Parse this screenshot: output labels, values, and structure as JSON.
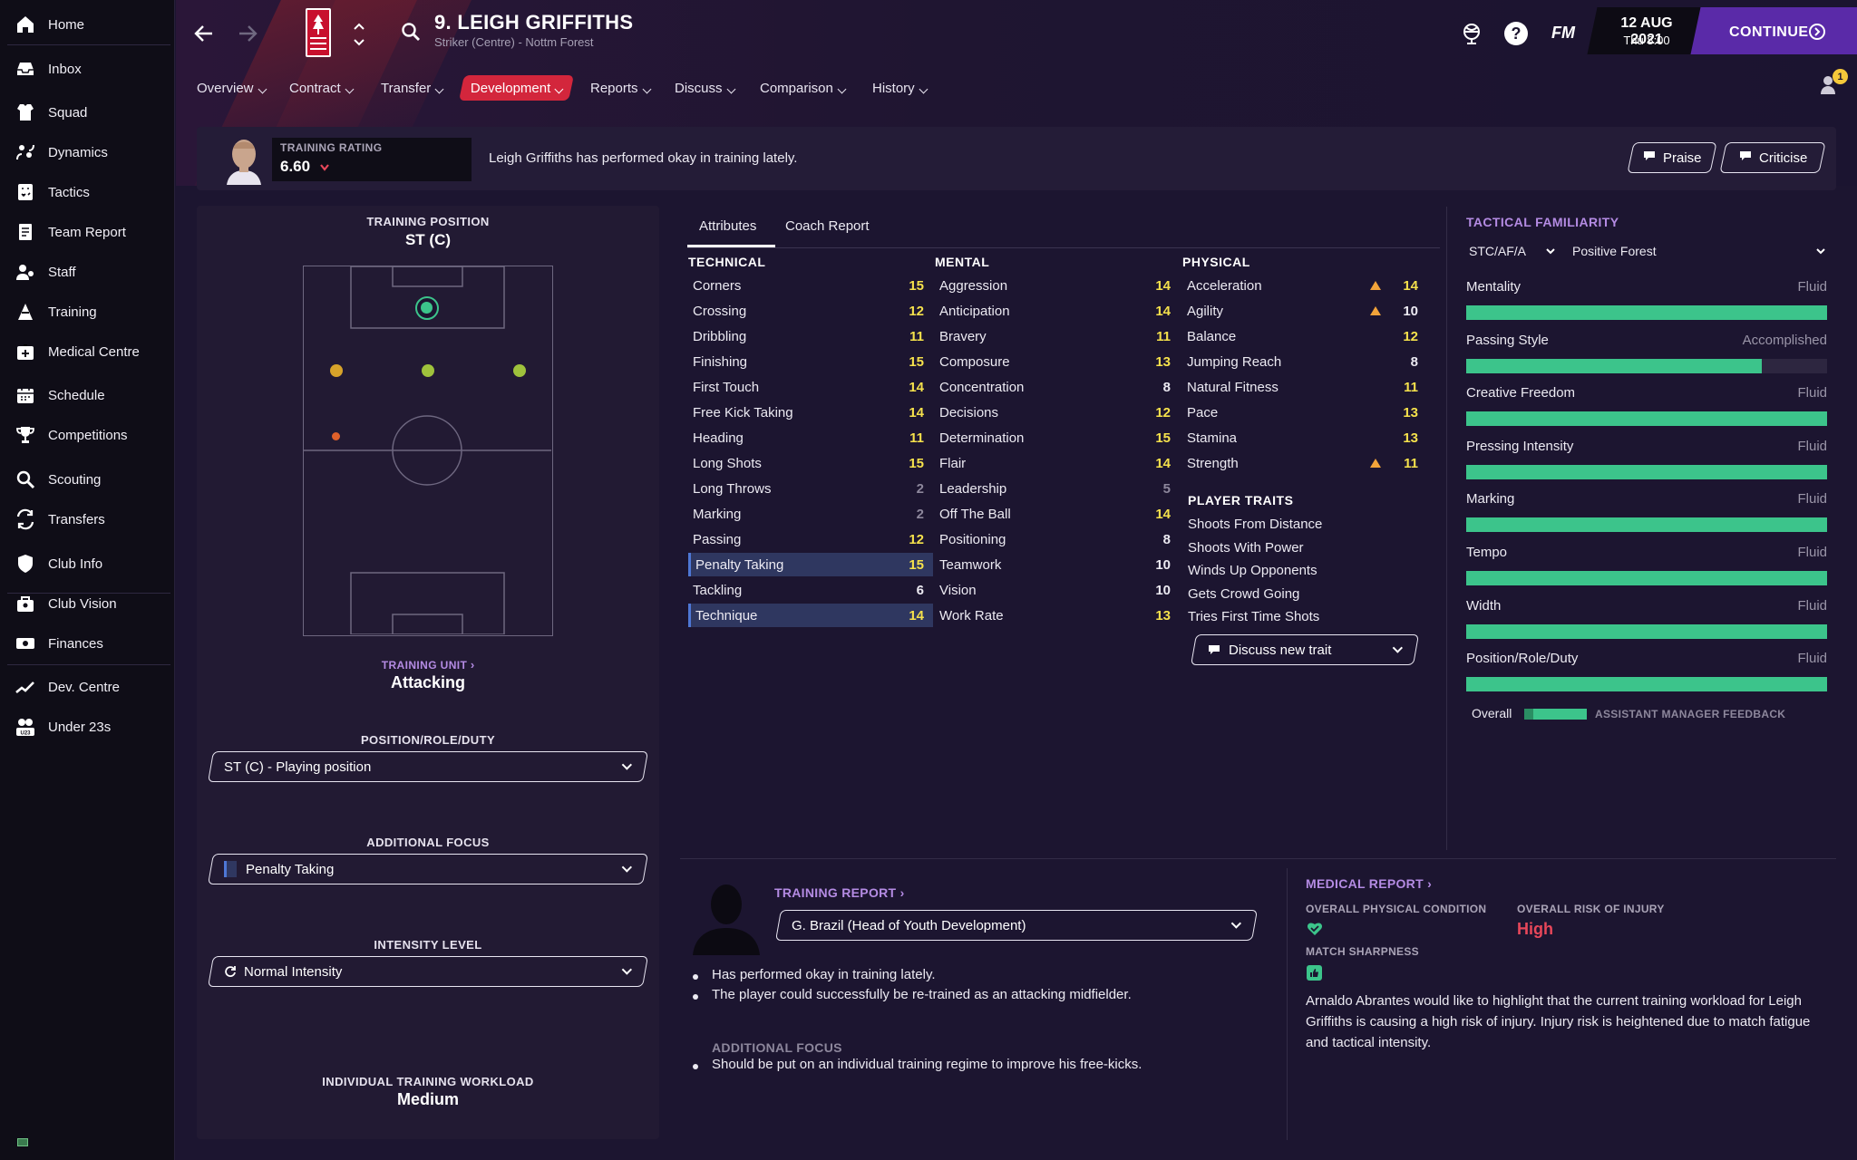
{
  "sidebar": {
    "items": [
      {
        "label": "Home",
        "icon": "home-icon"
      },
      {
        "label": "Inbox",
        "icon": "inbox-icon"
      },
      {
        "label": "Squad",
        "icon": "squad-icon"
      },
      {
        "label": "Dynamics",
        "icon": "dynamics-icon"
      },
      {
        "label": "Tactics",
        "icon": "tactics-icon"
      },
      {
        "label": "Team Report",
        "icon": "report-icon"
      },
      {
        "label": "Staff",
        "icon": "staff-icon"
      },
      {
        "label": "Training",
        "icon": "training-icon"
      },
      {
        "label": "Medical Centre",
        "icon": "medical-icon"
      },
      {
        "label": "Schedule",
        "icon": "calendar-icon"
      },
      {
        "label": "Competitions",
        "icon": "trophy-icon"
      },
      {
        "label": "Scouting",
        "icon": "search-icon"
      },
      {
        "label": "Transfers",
        "icon": "transfer-icon"
      },
      {
        "label": "Club Info",
        "icon": "shield-icon"
      },
      {
        "label": "Club Vision",
        "icon": "vision-icon"
      },
      {
        "label": "Finances",
        "icon": "finances-icon"
      },
      {
        "label": "Dev. Centre",
        "icon": "chart-icon"
      },
      {
        "label": "Under 23s",
        "icon": "u23-icon"
      }
    ]
  },
  "header": {
    "player_title": "9. LEIGH GRIFFITHS",
    "player_sub": "Striker (Centre) - Nottm Forest",
    "fm_label": "FM",
    "date": "12 AUG 2021",
    "time": "Thu 8:00",
    "continue_label": "CONTINUE",
    "notification_count": "1",
    "tabs": [
      "Overview",
      "Contract",
      "Transfer",
      "Development",
      "Reports",
      "Discuss",
      "Comparison",
      "History"
    ],
    "active_tab": "Development"
  },
  "rating": {
    "label": "TRAINING RATING",
    "value": "6.60",
    "message": "Leigh Griffiths has performed okay in training lately.",
    "praise": "Praise",
    "criticise": "Criticise"
  },
  "left": {
    "training_position_label": "TRAINING POSITION",
    "training_position": "ST (C)",
    "training_unit_label": "TRAINING UNIT",
    "training_unit": "Attacking",
    "prd_label": "POSITION/ROLE/DUTY",
    "prd_value": "ST (C) - Playing position",
    "focus_label": "ADDITIONAL FOCUS",
    "focus_value": "Penalty Taking",
    "intensity_label": "INTENSITY LEVEL",
    "intensity_value": "Normal Intensity",
    "workload_label": "INDIVIDUAL TRAINING WORKLOAD",
    "workload_value": "Medium"
  },
  "attr_tabs": [
    "Attributes",
    "Coach Report"
  ],
  "technical": {
    "title": "TECHNICAL",
    "rows": [
      {
        "name": "Corners",
        "value": "15"
      },
      {
        "name": "Crossing",
        "value": "12"
      },
      {
        "name": "Dribbling",
        "value": "11"
      },
      {
        "name": "Finishing",
        "value": "15"
      },
      {
        "name": "First Touch",
        "value": "14"
      },
      {
        "name": "Free Kick Taking",
        "value": "14"
      },
      {
        "name": "Heading",
        "value": "11"
      },
      {
        "name": "Long Shots",
        "value": "15"
      },
      {
        "name": "Long Throws",
        "value": "2"
      },
      {
        "name": "Marking",
        "value": "2"
      },
      {
        "name": "Passing",
        "value": "12"
      },
      {
        "name": "Penalty Taking",
        "value": "15",
        "hl": true
      },
      {
        "name": "Tackling",
        "value": "6"
      },
      {
        "name": "Technique",
        "value": "14",
        "hl": true
      }
    ]
  },
  "mental": {
    "title": "MENTAL",
    "rows": [
      {
        "name": "Aggression",
        "value": "14"
      },
      {
        "name": "Anticipation",
        "value": "14"
      },
      {
        "name": "Bravery",
        "value": "11"
      },
      {
        "name": "Composure",
        "value": "13"
      },
      {
        "name": "Concentration",
        "value": "8"
      },
      {
        "name": "Decisions",
        "value": "12"
      },
      {
        "name": "Determination",
        "value": "15"
      },
      {
        "name": "Flair",
        "value": "14"
      },
      {
        "name": "Leadership",
        "value": "5"
      },
      {
        "name": "Off The Ball",
        "value": "14"
      },
      {
        "name": "Positioning",
        "value": "8"
      },
      {
        "name": "Teamwork",
        "value": "10"
      },
      {
        "name": "Vision",
        "value": "10"
      },
      {
        "name": "Work Rate",
        "value": "13"
      }
    ]
  },
  "physical": {
    "title": "PHYSICAL",
    "rows": [
      {
        "name": "Acceleration",
        "value": "14",
        "up": true
      },
      {
        "name": "Agility",
        "value": "10",
        "up": true
      },
      {
        "name": "Balance",
        "value": "12"
      },
      {
        "name": "Jumping Reach",
        "value": "8"
      },
      {
        "name": "Natural Fitness",
        "value": "11"
      },
      {
        "name": "Pace",
        "value": "13"
      },
      {
        "name": "Stamina",
        "value": "13"
      },
      {
        "name": "Strength",
        "value": "11",
        "up": true
      }
    ]
  },
  "traits": {
    "title": "PLAYER TRAITS",
    "items": [
      "Shoots From Distance",
      "Shoots With Power",
      "Winds Up Opponents",
      "Gets Crowd Going",
      "Tries First Time Shots"
    ],
    "discuss": "Discuss new trait"
  },
  "tactical": {
    "title": "TACTICAL FAMILIARITY",
    "position": "STC/AF/A",
    "tactic": "Positive Forest",
    "rows": [
      {
        "label": "Mentality",
        "value": "Fluid",
        "fill": 1.0
      },
      {
        "label": "Passing Style",
        "value": "Accomplished",
        "fill": 0.82
      },
      {
        "label": "Creative Freedom",
        "value": "Fluid",
        "fill": 1.0
      },
      {
        "label": "Pressing Intensity",
        "value": "Fluid",
        "fill": 1.0
      },
      {
        "label": "Marking",
        "value": "Fluid",
        "fill": 1.0
      },
      {
        "label": "Tempo",
        "value": "Fluid",
        "fill": 1.0
      },
      {
        "label": "Width",
        "value": "Fluid",
        "fill": 1.0
      },
      {
        "label": "Position/Role/Duty",
        "value": "Fluid",
        "fill": 1.0
      }
    ],
    "overall_label": "Overall",
    "assistant_label": "ASSISTANT MANAGER FEEDBACK"
  },
  "training_report": {
    "title": "TRAINING REPORT",
    "coach": "G. Brazil (Head of Youth Development)",
    "bullets": [
      "Has performed okay in training lately.",
      "The player could successfully be re-trained as an attacking midfielder."
    ],
    "focus_title": "ADDITIONAL FOCUS",
    "focus_bullet": "Should be put on an individual training regime to improve his free-kicks."
  },
  "medical": {
    "title": "MEDICAL REPORT",
    "condition_label": "OVERALL PHYSICAL CONDITION",
    "risk_label": "OVERALL RISK OF INJURY",
    "risk_value": "High",
    "sharpness_label": "MATCH SHARPNESS",
    "text": "Arnaldo Abrantes would like to highlight that the current training workload for Leigh Griffiths is causing a high risk of injury. Injury risk is heightened due to match fatigue and tactical intensity."
  },
  "colors": {
    "accent": "#d3263c",
    "green": "#3cc48b",
    "purple": "#b48be3",
    "yellow": "#f5e14c",
    "red": "#e8475a"
  }
}
